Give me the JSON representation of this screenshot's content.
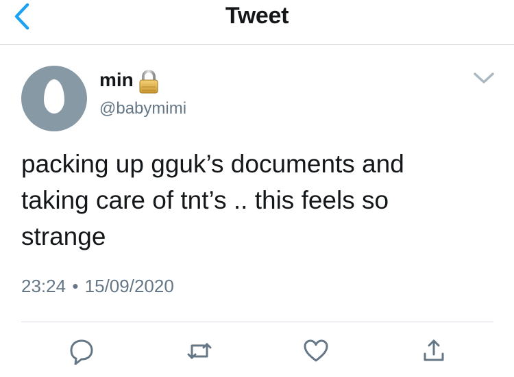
{
  "nav": {
    "title": "Tweet",
    "back_icon": "chevron-left-icon"
  },
  "tweet": {
    "author": {
      "display_name": "min",
      "handle": "@babymimi",
      "protected": true,
      "lock_icon": "lock-icon",
      "avatar": "default-egg-avatar"
    },
    "text": "packing up gguk’s documents and\ntaking care of tnt’s .. this feels so\nstrange",
    "time": "23:24",
    "separator": "•",
    "date": "15/09/2020",
    "menu_icon": "chevron-down-icon"
  },
  "actions": [
    {
      "name": "reply",
      "icon": "reply-icon"
    },
    {
      "name": "retweet",
      "icon": "retweet-icon"
    },
    {
      "name": "like",
      "icon": "heart-icon"
    },
    {
      "name": "share",
      "icon": "share-icon"
    }
  ],
  "colors": {
    "accent": "#1da1f2",
    "text": "#14171a",
    "secondary": "#657786",
    "avatar_bg": "#8899a6",
    "divider": "#d5dbe0"
  }
}
